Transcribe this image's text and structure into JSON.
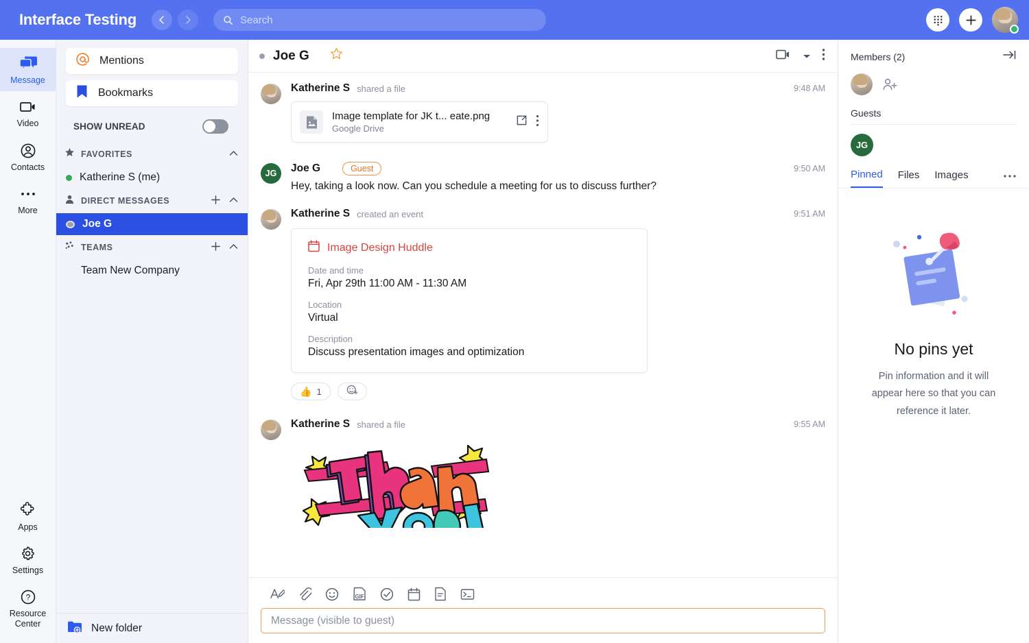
{
  "topbar": {
    "app_title": "Interface Testing",
    "back_icon": "chevron-left-icon",
    "forward_icon": "chevron-right-icon",
    "search_placeholder": "Search",
    "search_value": "",
    "dialpad_icon": "dialpad-icon",
    "add_icon": "plus-icon",
    "avatar_name": "Katherine S",
    "accent": "#5472f0"
  },
  "rail": {
    "items": [
      {
        "label": "Message",
        "icon": "message-icon",
        "active": true
      },
      {
        "label": "Video",
        "icon": "video-icon",
        "active": false
      },
      {
        "label": "Contacts",
        "icon": "contacts-icon",
        "active": false
      },
      {
        "label": "More",
        "icon": "more-dots-icon",
        "active": false
      }
    ],
    "bottom_items": [
      {
        "label": "Apps",
        "icon": "apps-puzzle-icon"
      },
      {
        "label": "Settings",
        "icon": "gear-icon"
      },
      {
        "label": "Resource Center",
        "icon": "question-circle-icon"
      }
    ]
  },
  "sidebar": {
    "mentions_label": "Mentions",
    "bookmarks_label": "Bookmarks",
    "show_unread_label": "SHOW UNREAD",
    "show_unread_on": false,
    "sections": [
      {
        "title": "FAVORITES",
        "icon": "star-icon",
        "has_add": false,
        "items": [
          {
            "label": "Katherine S (me)",
            "presence": "green",
            "selected": false
          }
        ]
      },
      {
        "title": "DIRECT MESSAGES",
        "icon": "person-icon",
        "has_add": true,
        "items": [
          {
            "label": "Joe G",
            "presence": "grey",
            "selected": true
          }
        ]
      },
      {
        "title": "TEAMS",
        "icon": "teams-icon",
        "has_add": true,
        "teams": [
          {
            "label": "Team New Company"
          }
        ]
      }
    ],
    "new_folder_label": "New folder",
    "new_folder_icon": "folder-plus-icon"
  },
  "conversation": {
    "header": {
      "name": "Joe G",
      "presence": "grey",
      "star_icon": "star-outline-icon",
      "video_icon": "video-camera-icon",
      "caret_icon": "caret-down-icon",
      "more_icon": "vertical-dots-icon"
    },
    "messages": [
      {
        "author": "Katherine S",
        "action": "shared a file",
        "time": "9:48 AM",
        "avatar_type": "photo",
        "type": "file",
        "file": {
          "name": "Image template for JK t... eate.png",
          "source": "Google Drive",
          "thumb_icon": "image-file-icon",
          "open_icon": "external-link-icon",
          "more_icon": "vertical-dots-icon"
        }
      },
      {
        "author": "Joe G",
        "badge": "Guest",
        "time": "9:50 AM",
        "avatar_type": "initials",
        "initials": "JG",
        "type": "text",
        "text": "Hey, taking a look now. Can you schedule a meeting for us to discuss further?"
      },
      {
        "author": "Katherine S",
        "action": "created an event",
        "time": "9:51 AM",
        "avatar_type": "photo",
        "type": "event",
        "event": {
          "icon": "calendar-icon",
          "title": "Image Design Huddle",
          "fields": [
            {
              "label": "Date and time",
              "value": "Fri, Apr 29th 11:00 AM - 11:30 AM"
            },
            {
              "label": "Location",
              "value": "Virtual"
            },
            {
              "label": "Description",
              "value": "Discuss presentation images and optimization"
            }
          ]
        },
        "reactions": [
          {
            "emoji": "👍",
            "count": "1"
          },
          {
            "emoji": "add-reaction-icon",
            "count": ""
          }
        ]
      },
      {
        "author": "Katherine S",
        "action": "shared a file",
        "time": "9:55 AM",
        "avatar_type": "photo",
        "type": "image",
        "image_alt": "Thank You graffiti artwork"
      }
    ],
    "composer": {
      "tools": [
        "format-text-icon",
        "attachment-paperclip-icon",
        "emoji-smiley-icon",
        "gif-icon",
        "task-check-icon",
        "calendar-icon",
        "note-icon",
        "code-terminal-icon"
      ],
      "placeholder": "Message (visible to guest)",
      "value": ""
    }
  },
  "right_panel": {
    "members_label": "Members (2)",
    "collapse_icon": "collapse-right-icon",
    "add_member_icon": "add-person-icon",
    "guests_label": "Guests",
    "guest_initials": "JG",
    "tabs": [
      {
        "label": "Pinned",
        "active": true
      },
      {
        "label": "Files",
        "active": false
      },
      {
        "label": "Images",
        "active": false
      }
    ],
    "tabs_more_icon": "horizontal-dots-icon",
    "empty_state": {
      "illustration": "pinned-note-illustration",
      "title": "No pins yet",
      "subtitle": "Pin information and it will appear here so that you can reference it later."
    }
  }
}
